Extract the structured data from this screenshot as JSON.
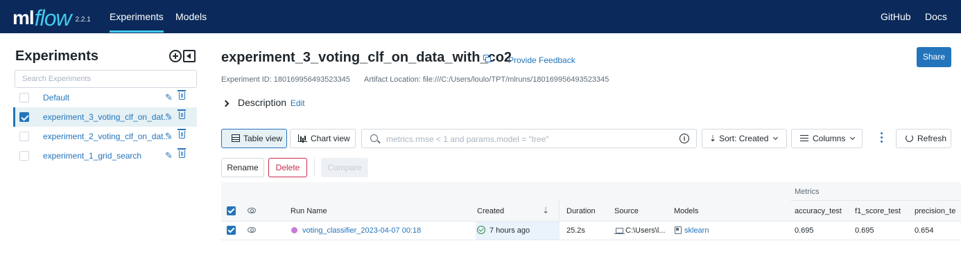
{
  "app": {
    "logo_ml": "ml",
    "logo_flow": "flow",
    "version": "2.2.1",
    "nav": [
      "Experiments",
      "Models"
    ],
    "nav_right": [
      "GitHub",
      "Docs"
    ],
    "colors": {
      "nav_bg": "#0b2a5b",
      "accent": "#43c9ed",
      "link": "#2374bb",
      "danger": "#c82d4c"
    }
  },
  "sidebar": {
    "title": "Experiments",
    "search_placeholder": "Search Experiments",
    "items": [
      {
        "label": "Default",
        "selected": false
      },
      {
        "label": "experiment_3_voting_clf_on_dat...",
        "selected": true
      },
      {
        "label": "experiment_2_voting_clf_on_dat...",
        "selected": false
      },
      {
        "label": "experiment_1_grid_search",
        "selected": false
      }
    ]
  },
  "main": {
    "title": "experiment_3_voting_clf_on_data_with_co2",
    "feedback_label": "Provide Feedback",
    "share_label": "Share",
    "experiment_id": "Experiment ID: 180169956493523345",
    "artifact_location": "Artifact Location: file:///C:/Users/loulo/TPT/mlruns/180169956493523345",
    "description_label": "Description",
    "description_edit": "Edit"
  },
  "toolbar": {
    "table_view": "Table view",
    "chart_view": "Chart view",
    "search_placeholder": "metrics.rmse < 1 and params.model = \"tree\"",
    "info": "i",
    "sort_label": "Sort: Created",
    "columns_label": "Columns",
    "refresh_label": "Refresh"
  },
  "actions": {
    "rename": "Rename",
    "delete": "Delete",
    "compare": "Compare"
  },
  "table": {
    "group_header": "Metrics",
    "columns": [
      "Run Name",
      "Created",
      "Duration",
      "Source",
      "Models",
      "accuracy_test",
      "f1_score_test",
      "precision_te"
    ],
    "sort_glyph": "⇣",
    "rows": [
      {
        "run_name": "voting_classifier_2023-04-07 00:18",
        "created": "7 hours ago",
        "duration": "25.2s",
        "source": "C:\\Users\\l...",
        "model": "sklearn",
        "accuracy_test": "0.695",
        "f1_score_test": "0.695",
        "precision_test": "0.654",
        "color": "#c77bd4"
      }
    ]
  }
}
